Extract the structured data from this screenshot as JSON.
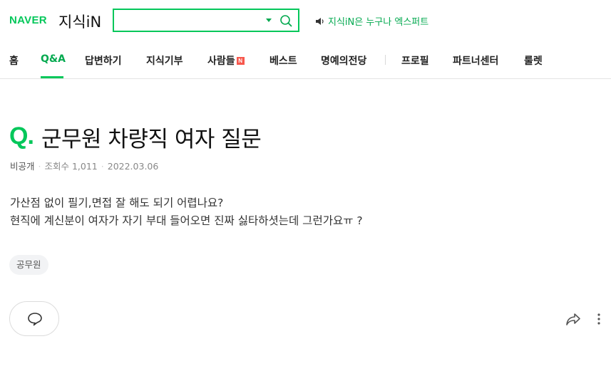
{
  "header": {
    "logo_brand": "NAVER",
    "logo_service": "지식iN",
    "search": {
      "value": "",
      "placeholder": ""
    },
    "expert_link": "지식iN은 누구나 엑스퍼트",
    "icons": {
      "search": "search-icon",
      "dropdown": "chevron-down-icon",
      "speaker": "speaker-icon"
    }
  },
  "nav": {
    "items": [
      {
        "label": "홈"
      },
      {
        "label": "Q&A",
        "active": true
      },
      {
        "label": "답변하기"
      },
      {
        "label": "지식기부"
      },
      {
        "label": "사람들",
        "badge": "N"
      },
      {
        "label": "베스트"
      },
      {
        "label": "명예의전당"
      },
      {
        "label": "프로필"
      },
      {
        "label": "파트너센터"
      },
      {
        "label": "룰렛"
      }
    ]
  },
  "question": {
    "mark": "Q.",
    "title": "군무원 차량직 여자 질문",
    "author": "비공개",
    "views": "조회수 1,011",
    "date": "2022.03.06",
    "body_lines": [
      "가산점 없이 필기,면접 잘 해도 되기 어렵나요?",
      "현직에 계신분이 여자가 자기 부대 들어오면 진짜 싫타하셧는데 그런가요ㅠ ?"
    ],
    "tag": "공무원"
  },
  "actions": {
    "comment_icon": "comment-icon",
    "share_icon": "share-icon",
    "more_icon": "more-vertical-icon"
  },
  "colors": {
    "brand_green": "#03c75a",
    "accent_green": "#03a94f",
    "new_badge": "#f7584d"
  }
}
